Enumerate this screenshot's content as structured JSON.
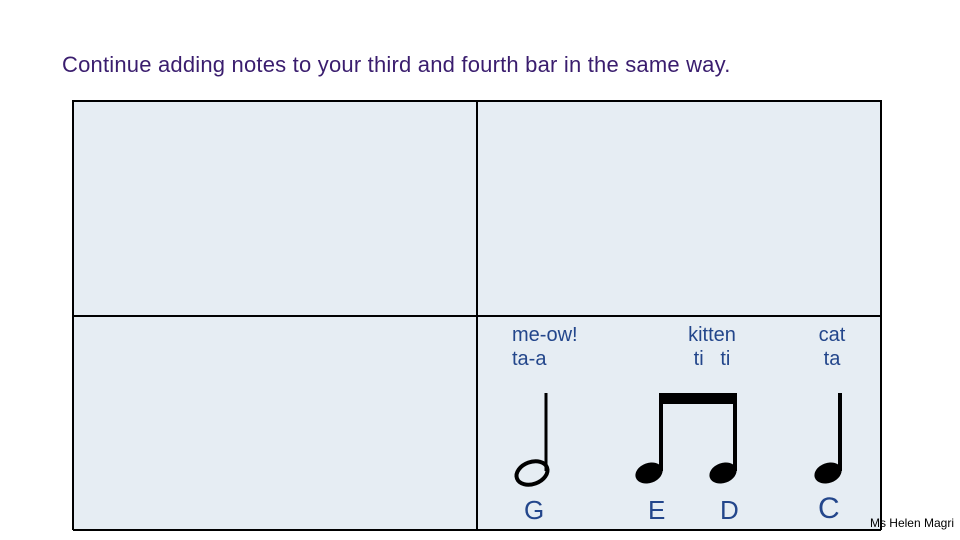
{
  "instruction": "Continue adding notes to your third and fourth bar in the same way.",
  "bars": {
    "bar4": {
      "beats": [
        {
          "word": "me-ow!",
          "rhythm": "ta-a",
          "letter": "G",
          "note": "half"
        },
        {
          "word": "kitten",
          "rhythm": "ti   ti",
          "letter_pair": [
            "E",
            "D"
          ],
          "note": "beamed-eighths"
        },
        {
          "word": "cat",
          "rhythm": "ta",
          "letter": "C",
          "note": "quarter"
        }
      ]
    }
  },
  "letters": {
    "g": "G",
    "e": "E",
    "d": "D",
    "c": "C"
  },
  "credit": "Ms Helen Magri",
  "colors": {
    "instruction": "#3a1d6e",
    "text": "#23468b",
    "panel": "#e6edf3"
  }
}
